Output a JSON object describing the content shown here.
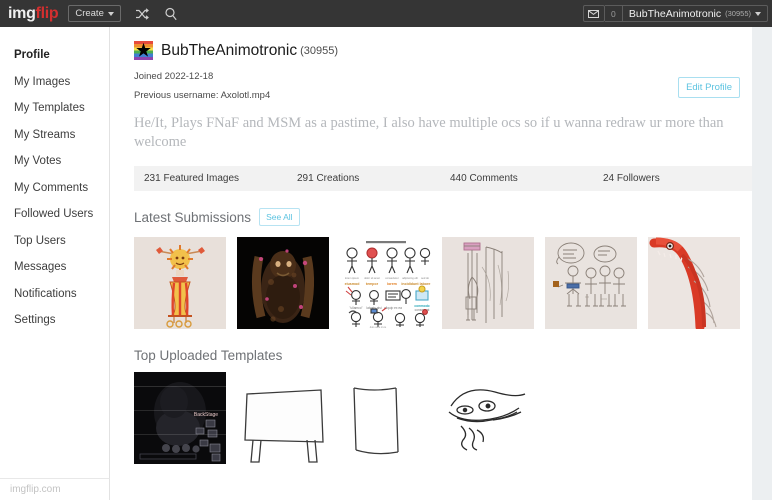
{
  "topnav": {
    "logo_img": "img",
    "logo_flip": "flip",
    "create_label": "Create",
    "shuffle_icon": "shuffle-icon",
    "search_icon": "search-icon",
    "mail_icon": "envelope-icon",
    "message_count": "0",
    "username": "BubTheAnimotronic",
    "user_points": "(30955)"
  },
  "sidebar": {
    "items": [
      {
        "label": "Profile",
        "active": true
      },
      {
        "label": "My Images",
        "active": false
      },
      {
        "label": "My Templates",
        "active": false
      },
      {
        "label": "My Streams",
        "active": false
      },
      {
        "label": "My Votes",
        "active": false
      },
      {
        "label": "My Comments",
        "active": false
      },
      {
        "label": "Followed Users",
        "active": false
      },
      {
        "label": "Top Users",
        "active": false
      },
      {
        "label": "Messages",
        "active": false
      },
      {
        "label": "Notifications",
        "active": false
      },
      {
        "label": "Settings",
        "active": false
      }
    ],
    "footer_label": "imgflip.com"
  },
  "profile": {
    "avatar_icon": "rainbow-star-avatar",
    "display_name": "BubTheAnimotronic",
    "points": "(30955)",
    "joined": "Joined 2022-12-18",
    "previous_username": "Previous username: Axolotl.mp4",
    "edit_button": "Edit Profile",
    "bio": "He/It, Plays FNaF and MSM as a pastime, I also have multiple ocs so if u wanna redraw ur more than welcome",
    "stats": [
      "231 Featured Images",
      "291 Creations",
      "440 Comments",
      "24 Followers"
    ]
  },
  "latest_submissions": {
    "title": "Latest Submissions",
    "see_all_label": "See All",
    "thumbnails": [
      {
        "name": "sun-creature-drawing"
      },
      {
        "name": "dark-animatronic-render"
      },
      {
        "name": "chart-of-stick-figures"
      },
      {
        "name": "pencil-sketch-tall-figure"
      },
      {
        "name": "pencil-sketch-group"
      },
      {
        "name": "red-creature-drawing"
      }
    ]
  },
  "top_templates": {
    "title": "Top Uploaded Templates",
    "thumbnails": [
      {
        "name": "dark-security-camera-template"
      },
      {
        "name": "blank-sign-template"
      },
      {
        "name": "narrow-sign-template"
      },
      {
        "name": "snake-sketch-template"
      }
    ]
  }
}
